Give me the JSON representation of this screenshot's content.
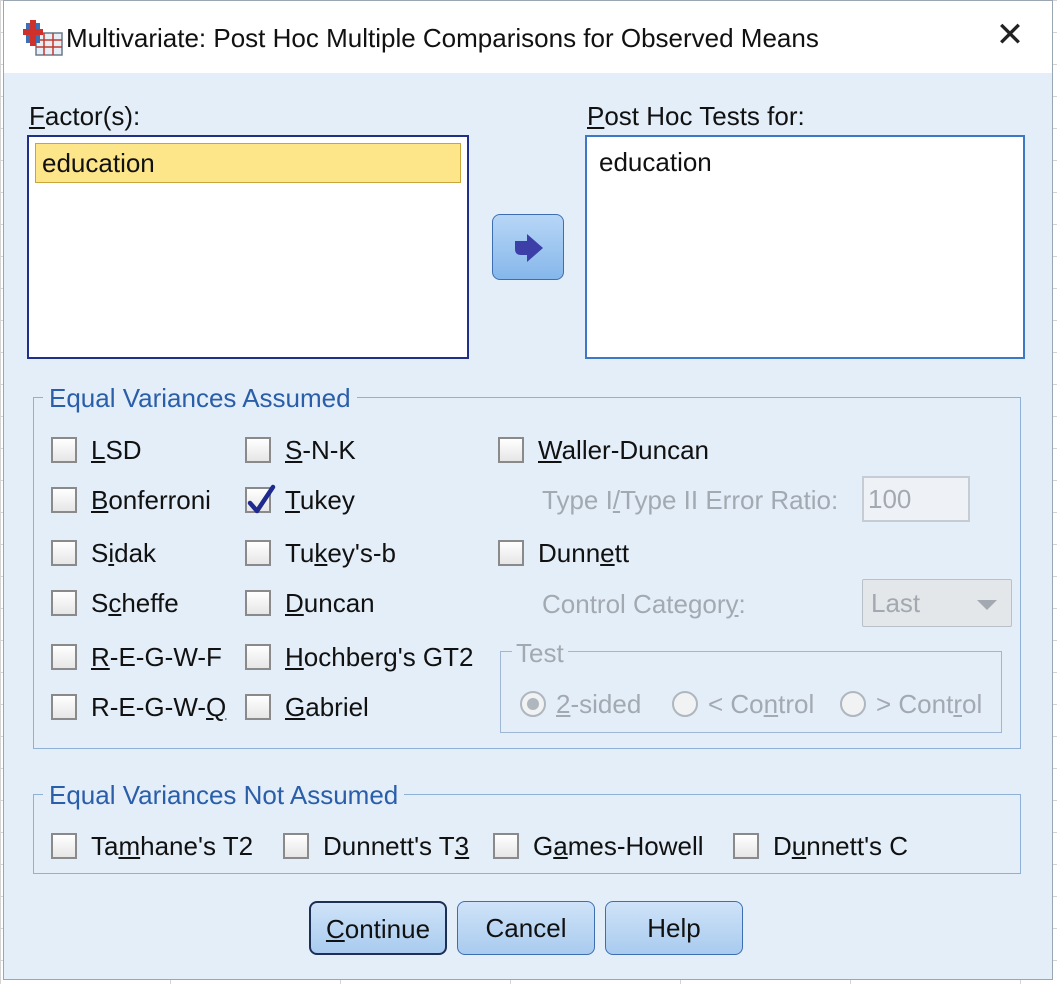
{
  "window": {
    "title": "Multivariate: Post Hoc Multiple Comparisons for Observed Means",
    "close_glyph": "✕"
  },
  "factors": {
    "label_mn": "F",
    "label_rest": "actor(s):",
    "items": [
      "education"
    ]
  },
  "posthoc": {
    "label_mn": "P",
    "label_rest": "ost Hoc Tests for:",
    "items": [
      "education"
    ]
  },
  "move_button": {
    "icon": "arrow-right-icon"
  },
  "equal_assumed": {
    "title": "Equal Variances Assumed",
    "col1": [
      {
        "pre": "",
        "mn": "L",
        "post": "SD",
        "checked": false
      },
      {
        "pre": "",
        "mn": "B",
        "post": "onferroni",
        "checked": false
      },
      {
        "pre": "S",
        "mn": "i",
        "post": "dak",
        "checked": false
      },
      {
        "pre": "S",
        "mn": "c",
        "post": "heffe",
        "checked": false
      },
      {
        "pre": "",
        "mn": "R",
        "post": "-E-G-W-F",
        "checked": false
      },
      {
        "pre": "R-E-G-W-",
        "mn": "Q",
        "post": "",
        "checked": false
      }
    ],
    "col2": [
      {
        "pre": "",
        "mn": "S",
        "post": "-N-K",
        "checked": false
      },
      {
        "pre": "",
        "mn": "T",
        "post": "ukey",
        "checked": true
      },
      {
        "pre": "Tu",
        "mn": "k",
        "post": "ey's-b",
        "checked": false
      },
      {
        "pre": "",
        "mn": "D",
        "post": "uncan",
        "checked": false
      },
      {
        "pre": "",
        "mn": "H",
        "post": "ochberg's GT2",
        "checked": false
      },
      {
        "pre": "",
        "mn": "G",
        "post": "abriel",
        "checked": false
      }
    ],
    "waller": {
      "pre": "",
      "mn": "W",
      "post": "aller-Duncan",
      "checked": false
    },
    "ratio_label": {
      "pre": "Type I",
      "mn": "/",
      "post": "Type II Error Ratio:"
    },
    "ratio_value": "100",
    "dunnett": {
      "pre": "Dunn",
      "mn": "e",
      "post": "tt",
      "checked": false
    },
    "control_label": {
      "pre": "Control Categor",
      "mn": "y",
      "post": ":"
    },
    "control_value": "Last",
    "test": {
      "title": "Test",
      "options": [
        {
          "pre": "",
          "mn": "2",
          "post": "-sided",
          "selected": true
        },
        {
          "pre": "< Co",
          "mn": "n",
          "post": "trol",
          "selected": false
        },
        {
          "pre": "> Cont",
          "mn": "r",
          "post": "ol",
          "selected": false
        }
      ]
    }
  },
  "equal_not_assumed": {
    "title": "Equal Variances Not Assumed",
    "items": [
      {
        "pre": "Ta",
        "mn": "m",
        "post": "hane's T2",
        "checked": false
      },
      {
        "pre": "Dunnett's T",
        "mn": "3",
        "post": "",
        "checked": false
      },
      {
        "pre": "G",
        "mn": "a",
        "post": "mes-Howell",
        "checked": false
      },
      {
        "pre": "D",
        "mn": "u",
        "post": "nnett's C",
        "checked": false
      }
    ]
  },
  "buttons": {
    "continue": {
      "pre": "",
      "mn": "C",
      "post": "ontinue"
    },
    "cancel": "Cancel",
    "help": "Help"
  }
}
